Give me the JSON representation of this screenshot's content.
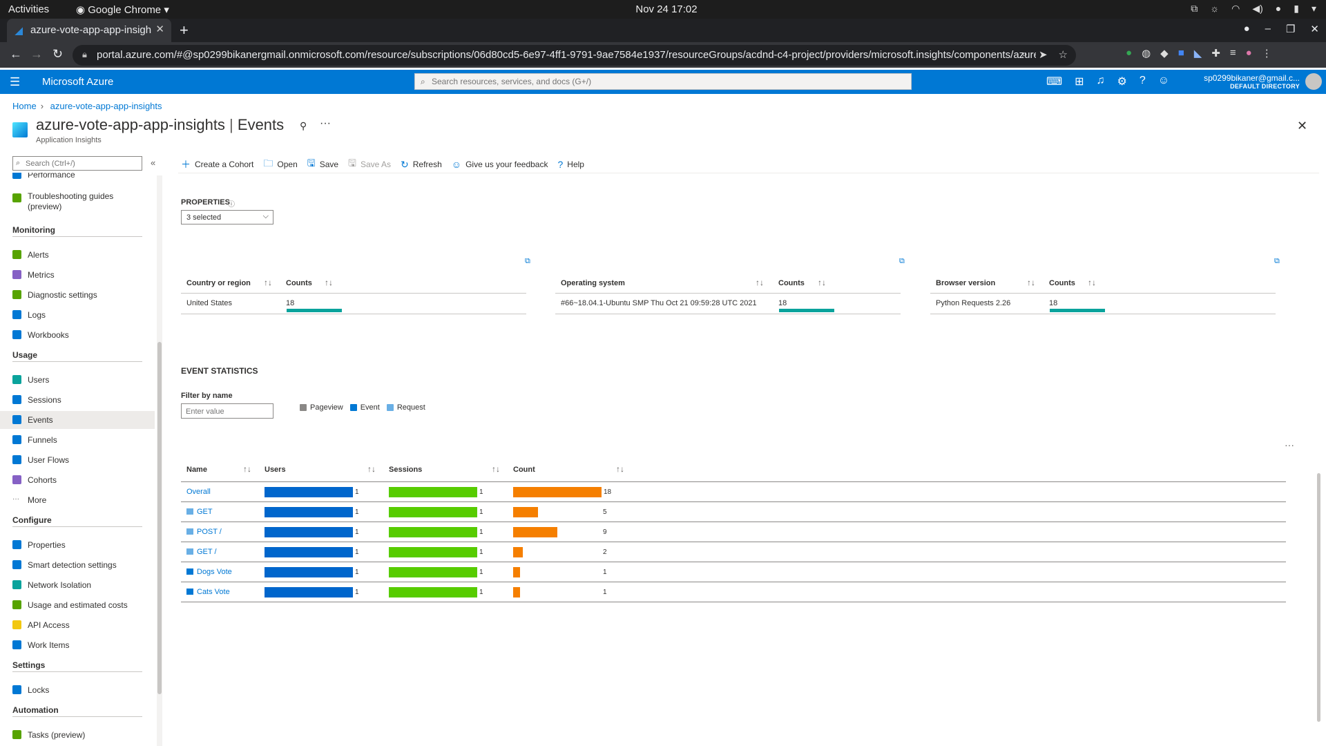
{
  "gnome": {
    "activities": "Activities",
    "app": "Google Chrome",
    "clock": "Nov 24  17:02"
  },
  "browser": {
    "tab_title": "azure-vote-app-app-insigh",
    "url": "portal.azure.com/#@sp0299bikanergmail.onmicrosoft.com/resource/subscriptions/06d80cd5-6e97-4ff1-9791-9ae7584e1937/resourceGroups/acdnd-c4-project/providers/microsoft.insights/components/azure-vote-ap..."
  },
  "azure": {
    "brand": "Microsoft Azure",
    "search_placeholder": "Search resources, services, and docs (G+/)",
    "user_email": "sp0299bikaner@gmail.c...",
    "user_directory": "DEFAULT DIRECTORY",
    "accent": "#0078d4"
  },
  "breadcrumb": [
    "Home",
    "azure-vote-app-app-insights"
  ],
  "page": {
    "resource": "azure-vote-app-app-insights",
    "separator": " | ",
    "section": "Events",
    "subtitle": "Application Insights"
  },
  "sidebar": {
    "search_placeholder": "Search (Ctrl+/)",
    "partial_top": "Performance",
    "items": [
      {
        "label": "Troubleshooting guides (preview)",
        "icon": "troubleshoot-icon",
        "color": "#57a300"
      },
      {
        "label": "Alerts",
        "icon": "alert-icon",
        "color": "#57a300"
      },
      {
        "label": "Metrics",
        "icon": "metrics-icon",
        "color": "#8661c5"
      },
      {
        "label": "Diagnostic settings",
        "icon": "diagnostic-icon",
        "color": "#57a300"
      },
      {
        "label": "Logs",
        "icon": "logs-icon",
        "color": "#0078d4"
      },
      {
        "label": "Workbooks",
        "icon": "workbooks-icon",
        "color": "#0078d4"
      },
      {
        "label": "Users",
        "icon": "users-icon",
        "color": "#0aa39c"
      },
      {
        "label": "Sessions",
        "icon": "sessions-icon",
        "color": "#0078d4"
      },
      {
        "label": "Events",
        "icon": "events-icon",
        "color": "#0078d4"
      },
      {
        "label": "Funnels",
        "icon": "funnels-icon",
        "color": "#0078d4"
      },
      {
        "label": "User Flows",
        "icon": "user-flows-icon",
        "color": "#0078d4"
      },
      {
        "label": "Cohorts",
        "icon": "cohorts-icon",
        "color": "#8661c5"
      },
      {
        "label": "More",
        "icon": "more-icon",
        "color": "#605e5c"
      },
      {
        "label": "Properties",
        "icon": "properties-icon",
        "color": "#0078d4"
      },
      {
        "label": "Smart detection settings",
        "icon": "smart-detection-icon",
        "color": "#0078d4"
      },
      {
        "label": "Network Isolation",
        "icon": "network-icon",
        "color": "#0aa39c"
      },
      {
        "label": "Usage and estimated costs",
        "icon": "usage-costs-icon",
        "color": "#57a300"
      },
      {
        "label": "API Access",
        "icon": "api-key-icon",
        "color": "#f2c811"
      },
      {
        "label": "Work Items",
        "icon": "work-items-icon",
        "color": "#0078d4"
      },
      {
        "label": "Locks",
        "icon": "lock-icon",
        "color": "#0078d4"
      },
      {
        "label": "Tasks (preview)",
        "icon": "tasks-icon",
        "color": "#57a300"
      }
    ],
    "groups": [
      "Monitoring",
      "Usage",
      "Configure",
      "Settings",
      "Automation"
    ]
  },
  "commands": [
    {
      "label": "Create a Cohort",
      "icon": "plus-icon",
      "enabled": true
    },
    {
      "label": "Open",
      "icon": "folder-icon",
      "enabled": true
    },
    {
      "label": "Save",
      "icon": "save-icon",
      "enabled": true
    },
    {
      "label": "Save As",
      "icon": "save-as-icon",
      "enabled": false
    },
    {
      "label": "Refresh",
      "icon": "refresh-icon",
      "enabled": true
    },
    {
      "label": "Give us your feedback",
      "icon": "feedback-icon",
      "enabled": true
    },
    {
      "label": "Help",
      "icon": "help-icon",
      "enabled": true
    }
  ],
  "properties": {
    "label": "PROPERTIES",
    "selected": "3 selected",
    "tables": [
      {
        "dimension": "Country or region",
        "counts_label": "Counts",
        "value": "United States",
        "count": 18
      },
      {
        "dimension": "Operating system",
        "counts_label": "Counts",
        "value": "#66~18.04.1-Ubuntu SMP Thu Oct 21 09:59:28 UTC 2021",
        "count": 18
      },
      {
        "dimension": "Browser version",
        "counts_label": "Counts",
        "value": "Python Requests 2.26",
        "count": 18
      }
    ]
  },
  "event_statistics": {
    "title": "EVENT STATISTICS",
    "filter_label": "Filter by name",
    "filter_placeholder": "Enter value",
    "legend": [
      {
        "label": "Pageview",
        "color": "#8a8886"
      },
      {
        "label": "Event",
        "color": "#0078d4"
      },
      {
        "label": "Request",
        "color": "#69afe5"
      }
    ],
    "columns": [
      "Name",
      "Users",
      "Sessions",
      "Count"
    ],
    "colors": {
      "users": "#0066cc",
      "sessions": "#57cc00",
      "count": "#f57f00"
    },
    "max_count": 18,
    "rows": [
      {
        "name": "Overall",
        "type": "none",
        "users": 1,
        "sessions": 1,
        "count": 18
      },
      {
        "name": "GET",
        "type": "request",
        "users": 1,
        "sessions": 1,
        "count": 5
      },
      {
        "name": "POST /",
        "type": "request",
        "users": 1,
        "sessions": 1,
        "count": 9
      },
      {
        "name": "GET /",
        "type": "request",
        "users": 1,
        "sessions": 1,
        "count": 2
      },
      {
        "name": "Dogs Vote",
        "type": "event",
        "users": 1,
        "sessions": 1,
        "count": 1
      },
      {
        "name": "Cats Vote",
        "type": "event",
        "users": 1,
        "sessions": 1,
        "count": 1
      }
    ]
  }
}
